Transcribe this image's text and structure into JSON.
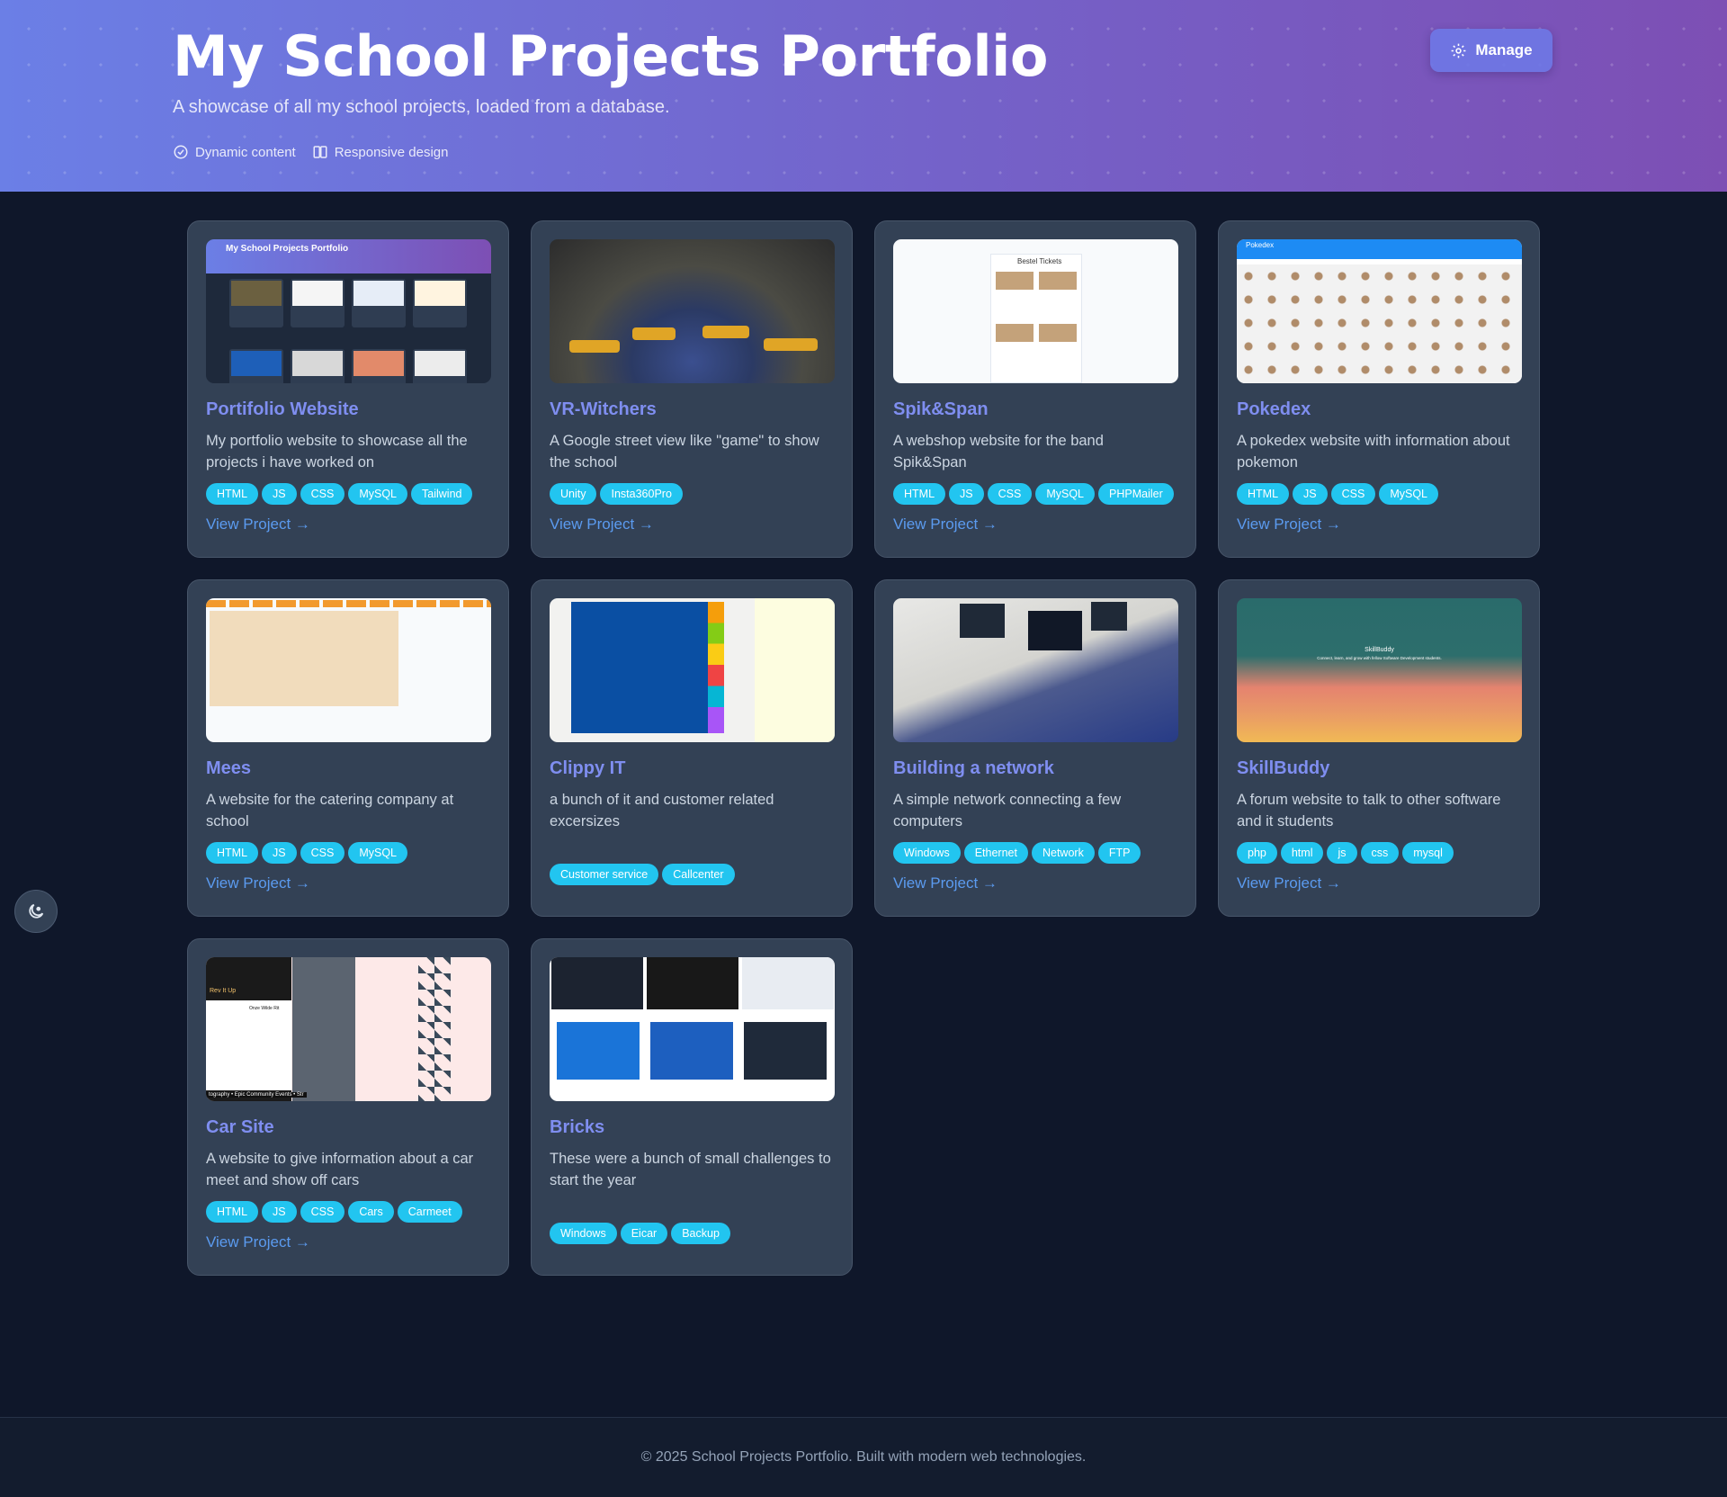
{
  "header": {
    "title": "My School Projects Portfolio",
    "subtitle": "A showcase of all my school projects, loaded from a database.",
    "features": [
      {
        "label": "Dynamic content",
        "icon": "check-circle-icon"
      },
      {
        "label": "Responsive design",
        "icon": "columns-icon"
      }
    ],
    "manage_label": "Manage",
    "accent_from": "#6b7fe6",
    "accent_to": "#7d4fb4"
  },
  "projects": [
    {
      "title": "Portifolio Website",
      "description": "My portfolio website to showcase all the projects i have worked on",
      "tags": [
        "HTML",
        "JS",
        "CSS",
        "MySQL",
        "Tailwind"
      ],
      "link": "View Project →"
    },
    {
      "title": "VR-Witchers",
      "description": "A Google street view like \"game\" to show the school",
      "tags": [
        "Unity",
        "Insta360Pro"
      ],
      "link": "View Project →"
    },
    {
      "title": "Spik&Span",
      "description": "A webshop website for the band Spik&Span",
      "tags": [
        "HTML",
        "JS",
        "CSS",
        "MySQL",
        "PHPMailer"
      ],
      "link": "View Project →"
    },
    {
      "title": "Pokedex",
      "description": "A pokedex website with information about pokemon",
      "tags": [
        "HTML",
        "JS",
        "CSS",
        "MySQL"
      ],
      "link": "View Project →"
    },
    {
      "title": "Mees",
      "description": "A website for the catering company at school",
      "tags": [
        "HTML",
        "JS",
        "CSS",
        "MySQL"
      ],
      "link": "View Project →"
    },
    {
      "title": "Clippy IT",
      "description": "a bunch of it and customer related excersizes",
      "tags": [
        "Customer service",
        "Callcenter"
      ],
      "link": ""
    },
    {
      "title": "Building a network",
      "description": "A simple network connecting a few computers",
      "tags": [
        "Windows",
        "Ethernet",
        "Network",
        "FTP"
      ],
      "link": "View Project →"
    },
    {
      "title": "SkillBuddy",
      "description": "A forum website to talk to other software and it students",
      "tags": [
        "php",
        "html",
        "js",
        "css",
        "mysql"
      ],
      "link": "View Project →"
    },
    {
      "title": "Car Site",
      "description": "A website to give information about a car meet and show off cars",
      "tags": [
        "HTML",
        "JS",
        "CSS",
        "Cars",
        "Carmeet"
      ],
      "link": "View Project →"
    },
    {
      "title": "Bricks",
      "description": "These were a bunch of small challenges to start the year",
      "tags": [
        "Windows",
        "Eicar",
        "Backup"
      ],
      "link": ""
    }
  ],
  "thumbnails": {
    "portfolio_title": "My School Projects Portfolio",
    "pokedex_title": "Pokedex",
    "spik_heading": "Bestel Tickets",
    "skill_name": "SkillBuddy",
    "skill_tagline": "Connect, learn, and grow with fellow Software Development students.",
    "car_hero": "Rev It Up",
    "car_heading": "Onze Wilde Rit",
    "car_footer": "tography • Epic Community Events • Str"
  },
  "theme_toggle_icon": "theme-toggle-icon",
  "footer": {
    "text": "© 2025 School Projects Portfolio. Built with modern web technologies."
  }
}
